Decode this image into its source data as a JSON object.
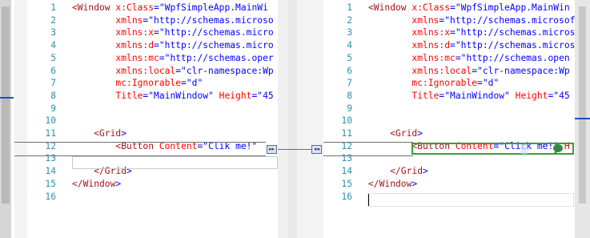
{
  "left_pane": {
    "line_numbers": [
      "1",
      "2",
      "3",
      "4",
      "5",
      "6",
      "7",
      "8",
      "9",
      "10",
      "11",
      "12",
      "13",
      "14",
      "15",
      "16"
    ],
    "lines": [
      [
        {
          "t": "tag",
          "v": "<Window"
        },
        {
          "t": "attr",
          "v": " x:Class"
        },
        {
          "t": "punct",
          "v": "="
        },
        {
          "t": "val",
          "v": "\"WpfSimpleApp.MainWi"
        }
      ],
      [
        {
          "t": "attr",
          "v": "        xmlns"
        },
        {
          "t": "punct",
          "v": "="
        },
        {
          "t": "val",
          "v": "\"http://schemas.microso"
        }
      ],
      [
        {
          "t": "attr",
          "v": "        xmlns:x"
        },
        {
          "t": "punct",
          "v": "="
        },
        {
          "t": "val",
          "v": "\"http://schemas.micro"
        }
      ],
      [
        {
          "t": "attr",
          "v": "        xmlns:d"
        },
        {
          "t": "punct",
          "v": "="
        },
        {
          "t": "val",
          "v": "\"http://schemas.micro"
        }
      ],
      [
        {
          "t": "attr",
          "v": "        xmlns:mc"
        },
        {
          "t": "punct",
          "v": "="
        },
        {
          "t": "val",
          "v": "\"http://schemas.oper"
        }
      ],
      [
        {
          "t": "attr",
          "v": "        xmlns:local"
        },
        {
          "t": "punct",
          "v": "="
        },
        {
          "t": "val",
          "v": "\"clr-namespace:Wp"
        }
      ],
      [
        {
          "t": "attr",
          "v": "        mc:Ignorable"
        },
        {
          "t": "punct",
          "v": "="
        },
        {
          "t": "val",
          "v": "\"d\""
        }
      ],
      [
        {
          "t": "attr",
          "v": "        Title"
        },
        {
          "t": "punct",
          "v": "="
        },
        {
          "t": "val",
          "v": "\"MainWindow\""
        },
        {
          "t": "attr",
          "v": " Height"
        },
        {
          "t": "punct",
          "v": "="
        },
        {
          "t": "val",
          "v": "\"45"
        }
      ],
      [],
      [],
      [
        {
          "t": "tag",
          "v": "    <Grid"
        },
        {
          "t": "punct",
          "v": ">"
        }
      ],
      [
        {
          "t": "tag",
          "v": "        <Button"
        },
        {
          "t": "attr",
          "v": " Content"
        },
        {
          "t": "punct",
          "v": "="
        },
        {
          "t": "val",
          "v": "\"Clik me!\""
        }
      ],
      [],
      [
        {
          "t": "tag",
          "v": "    </Grid"
        },
        {
          "t": "punct",
          "v": ">"
        }
      ],
      [
        {
          "t": "tag",
          "v": "</Window"
        },
        {
          "t": "punct",
          "v": ">"
        }
      ],
      []
    ]
  },
  "right_pane": {
    "line_numbers": [
      "1",
      "2",
      "3",
      "4",
      "5",
      "6",
      "7",
      "8",
      "9",
      "10",
      "11",
      "12",
      "13",
      "14",
      "15",
      "16"
    ],
    "lines": [
      [
        {
          "t": "tag",
          "v": "<Window"
        },
        {
          "t": "attr",
          "v": " x:Class"
        },
        {
          "t": "punct",
          "v": "="
        },
        {
          "t": "val",
          "v": "\"WpfSimpleApp.MainWin"
        }
      ],
      [
        {
          "t": "attr",
          "v": "        xmlns"
        },
        {
          "t": "punct",
          "v": "="
        },
        {
          "t": "val",
          "v": "\"http://schemas.microsof"
        }
      ],
      [
        {
          "t": "attr",
          "v": "        xmlns:x"
        },
        {
          "t": "punct",
          "v": "="
        },
        {
          "t": "val",
          "v": "\"http://schemas.micros"
        }
      ],
      [
        {
          "t": "attr",
          "v": "        xmlns:d"
        },
        {
          "t": "punct",
          "v": "="
        },
        {
          "t": "val",
          "v": "\"http://schemas.micros"
        }
      ],
      [
        {
          "t": "attr",
          "v": "        xmlns:mc"
        },
        {
          "t": "punct",
          "v": "="
        },
        {
          "t": "val",
          "v": "\"http://schemas.open"
        }
      ],
      [
        {
          "t": "attr",
          "v": "        xmlns:local"
        },
        {
          "t": "punct",
          "v": "="
        },
        {
          "t": "val",
          "v": "\"clr-namespace:Wp"
        }
      ],
      [
        {
          "t": "attr",
          "v": "        mc:Ignorable"
        },
        {
          "t": "punct",
          "v": "="
        },
        {
          "t": "val",
          "v": "\"d\""
        }
      ],
      [
        {
          "t": "attr",
          "v": "        Title"
        },
        {
          "t": "punct",
          "v": "="
        },
        {
          "t": "val",
          "v": "\"MainWindow\""
        },
        {
          "t": "attr",
          "v": " Height"
        },
        {
          "t": "punct",
          "v": "="
        },
        {
          "t": "val",
          "v": "\"45"
        }
      ],
      [],
      [],
      [
        {
          "t": "tag",
          "v": "    <Grid"
        },
        {
          "t": "punct",
          "v": ">"
        }
      ],
      [
        {
          "t": "tag",
          "v": "        <Button"
        },
        {
          "t": "attr",
          "v": " Content"
        },
        {
          "t": "punct",
          "v": "="
        },
        {
          "t": "val",
          "v": "\"Click me!\""
        },
        {
          "t": "attr",
          "v": " H"
        }
      ],
      [],
      [
        {
          "t": "tag",
          "v": "    </Grid"
        },
        {
          "t": "punct",
          "v": ">"
        }
      ],
      [
        {
          "t": "tag",
          "v": "</Window"
        },
        {
          "t": "punct",
          "v": ">"
        }
      ],
      []
    ]
  },
  "nav": {
    "next_diff_glyph": "▸▸",
    "prev_diff_glyph": "◂◂"
  },
  "colors": {
    "tag": "#a31515",
    "attr": "#ff0000",
    "value": "#0000ff",
    "line_number": "#2b91af",
    "diff_border": "#3c9a3c"
  }
}
